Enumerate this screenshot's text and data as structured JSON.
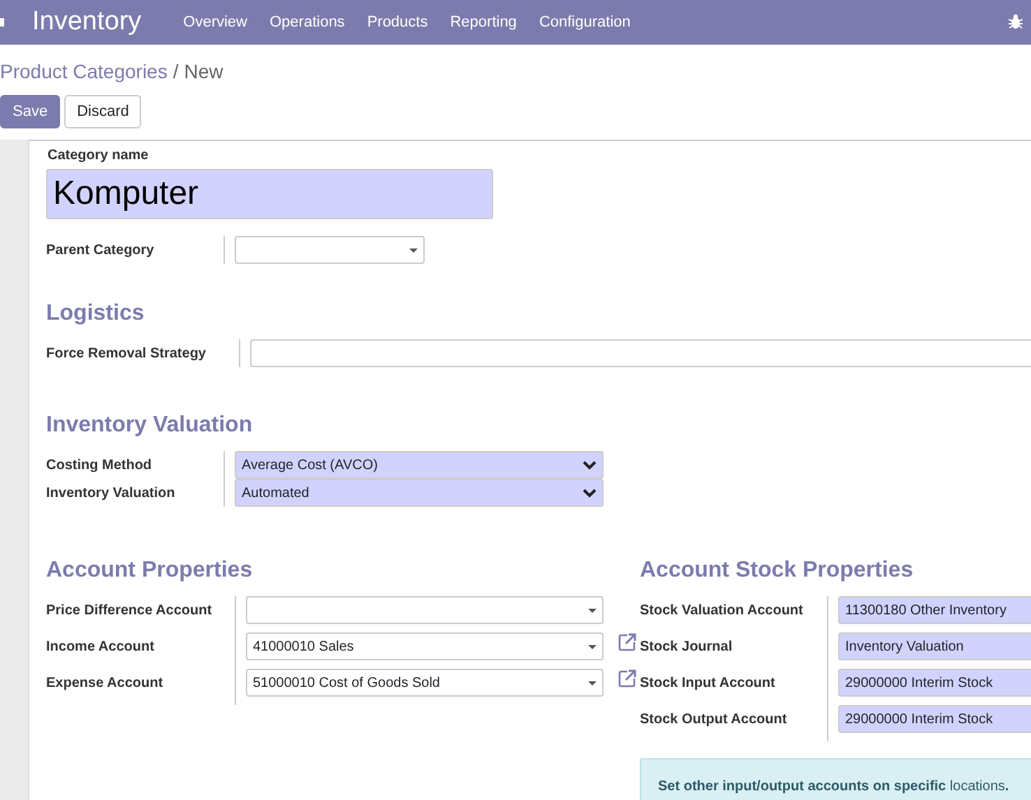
{
  "navbar": {
    "brand": "Inventory",
    "menu": [
      "Overview",
      "Operations",
      "Products",
      "Reporting",
      "Configuration"
    ]
  },
  "breadcrumb": {
    "separator": "/",
    "items": [
      {
        "label": "Product Categories",
        "link": true
      },
      {
        "label": "New",
        "link": false
      }
    ]
  },
  "buttons": [
    {
      "label": "Save",
      "kind": "primary"
    },
    {
      "label": "Discard",
      "kind": "secondary"
    }
  ],
  "category_name": {
    "label": "Category name",
    "value": "Komputer",
    "required": true
  },
  "sections": [
    {
      "kind": "plain",
      "groups": [
        {
          "fields": [
            {
              "label": "Parent Category",
              "kind": "many2one",
              "required": false,
              "external_link": false
            }
          ]
        }
      ]
    },
    {
      "kind": "titled",
      "title": "Logistics",
      "groups": [
        {
          "fields": [
            {
              "label": "Force Removal Strategy",
              "kind": "many2one",
              "required": false,
              "external_link": false
            }
          ]
        }
      ]
    },
    {
      "kind": "titled",
      "title": "Inventory Valuation",
      "groups": [
        {
          "fields": [
            {
              "label": "Costing Method",
              "kind": "selection",
              "value": "Average Cost (AVCO)",
              "required": true,
              "external_link": false
            },
            {
              "label": "Inventory Valuation",
              "kind": "selection",
              "value": "Automated",
              "required": true,
              "external_link": false
            }
          ]
        }
      ]
    },
    {
      "kind": "columns",
      "groups": [
        {
          "title": "Account Properties",
          "fields": [
            {
              "label": "Price Difference Account",
              "kind": "many2one",
              "required": false,
              "external_link": false
            },
            {
              "label": "Income Account",
              "kind": "many2one",
              "value": "41000010 Sales",
              "required": false,
              "external_link": true
            },
            {
              "label": "Expense Account",
              "kind": "many2one",
              "value": "51000010 Cost of Goods Sold",
              "required": false,
              "external_link": true
            }
          ]
        },
        {
          "title": "Account Stock Properties",
          "fields": [
            {
              "label": "Stock Valuation Account",
              "kind": "many2one",
              "value": "11300180 Other Inventory",
              "required": true,
              "external_link": false
            },
            {
              "label": "Stock Journal",
              "kind": "many2one",
              "value": "Inventory Valuation",
              "required": true,
              "external_link": false
            },
            {
              "label": "Stock Input Account",
              "kind": "many2one",
              "value": "29000000 Interim Stock",
              "required": true,
              "external_link": false
            },
            {
              "label": "Stock Output Account",
              "kind": "many2one",
              "value": "29000000 Interim Stock",
              "required": true,
              "external_link": false
            }
          ],
          "alert": {
            "text": "Set other input/output accounts on specific ",
            "link": "locations",
            "after": "."
          }
        }
      ]
    }
  ]
}
